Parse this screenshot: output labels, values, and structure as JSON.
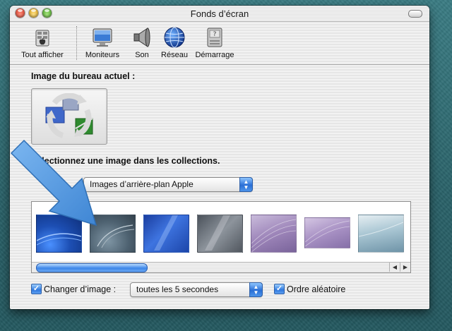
{
  "window": {
    "title": "Fonds d’écran"
  },
  "toolbar": {
    "items": [
      {
        "label": "Tout afficher",
        "icon": "show-all-icon"
      },
      {
        "label": "Moniteurs",
        "icon": "displays-icon"
      },
      {
        "label": "Son",
        "icon": "sound-icon"
      },
      {
        "label": "Réseau",
        "icon": "network-icon"
      },
      {
        "label": "Démarrage",
        "icon": "startup-disk-icon"
      }
    ]
  },
  "current_desktop": {
    "label": "Image du bureau actuel :",
    "icon": "recycle-desktop-icon"
  },
  "collections": {
    "label": "Sélectionnez une image dans les collections.",
    "popup_value": "Images d’arrière-plan Apple",
    "thumbnail_count": 7,
    "thumbnails": [
      {
        "name": "aqua-blue-wave",
        "color": "#1f5fbf"
      },
      {
        "name": "graphite-wave",
        "color": "#4f6372"
      },
      {
        "name": "blue-streak",
        "color": "#2a54b8"
      },
      {
        "name": "grey-streak",
        "color": "#69717a"
      },
      {
        "name": "lavender-fibres",
        "color": "#9e8ab6"
      },
      {
        "name": "lavender-fibres-2",
        "color": "#a995c0"
      },
      {
        "name": "ice-blue",
        "color": "#a9c6d3"
      }
    ],
    "scroll_position": 0.0
  },
  "options": {
    "change_picture_label": "Changer d’image :",
    "change_picture_checked": true,
    "interval_value": "toutes les 5 secondes",
    "random_label": "Ordre aléatoire",
    "random_checked": true
  },
  "colors": {
    "accent": "#3d86e8",
    "desktop": "#2e6c73",
    "arrow": "#4f96dc"
  }
}
